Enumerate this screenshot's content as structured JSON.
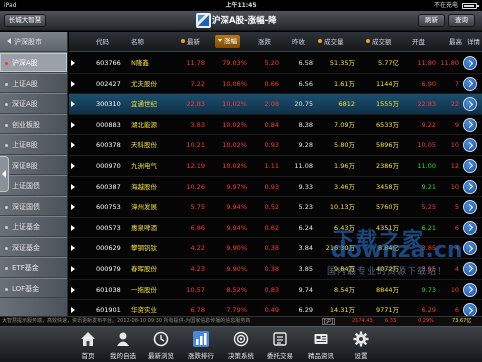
{
  "status_bar": {
    "device": "iPad",
    "time": "上午11:45",
    "right": "不在充电"
  },
  "header": {
    "back": "长城大智慧",
    "title": "沪深A股-涨幅-降",
    "refresh": "刷新",
    "search": "查询"
  },
  "sidebar": {
    "heading": "沪深股市",
    "items": [
      {
        "label": "沪深A股",
        "active": true
      },
      {
        "label": "上证A股"
      },
      {
        "label": "深证A股"
      },
      {
        "label": "创业板股"
      },
      {
        "label": "上证B股"
      },
      {
        "label": "深证B股"
      },
      {
        "label": "上证国债"
      },
      {
        "label": "深证国债"
      },
      {
        "label": "上证基金"
      },
      {
        "label": "深证基金"
      },
      {
        "label": "ETF基金"
      },
      {
        "label": "LOF基金"
      }
    ]
  },
  "table": {
    "columns": [
      "代码",
      "名称",
      "最新",
      "涨幅",
      "涨跌",
      "昨收",
      "成交量",
      "成交额",
      "开盘",
      "最高",
      "详情"
    ],
    "rows": [
      {
        "code": "603766",
        "name": "N隆鑫",
        "last": "11.78",
        "pct": "79.03%",
        "chg": "5.20",
        "prev": "6.58",
        "vol": "51.35万",
        "amt": "5.77亿",
        "open": "11.80",
        "high": "11.80",
        "dir": "up"
      },
      {
        "code": "002427",
        "name": "尤夫股份",
        "last": "7.22",
        "pct": "10.06%",
        "chg": "0.66",
        "prev": "6.56",
        "vol": "1.61万",
        "amt": "1144万",
        "open": "6.90",
        "high": "7",
        "dir": "up"
      },
      {
        "code": "300310",
        "name": "宜通世纪",
        "last": "22.83",
        "pct": "10.02%",
        "chg": "2.08",
        "prev": "20.75",
        "vol": "6812",
        "amt": "1555万",
        "open": "22.83",
        "high": "22",
        "dir": "up",
        "highlight": true
      },
      {
        "code": "000883",
        "name": "湖北能源",
        "last": "3.83",
        "pct": "10.02%",
        "chg": "0.84",
        "prev": "8.38",
        "vol": "7.09万",
        "amt": "6533万",
        "open": "9.22",
        "high": "9",
        "dir": "up"
      },
      {
        "code": "600378",
        "name": "天科股份",
        "last": "10.21",
        "pct": "10.02%",
        "chg": "0.93",
        "prev": "9.28",
        "vol": "5.80万",
        "amt": "5896万",
        "open": "10.05",
        "high": "10",
        "dir": "up"
      },
      {
        "code": "000970",
        "name": "九洲电气",
        "last": "12.19",
        "pct": "10.02%",
        "chg": "1.11",
        "prev": "11.08",
        "vol": "1.96万",
        "amt": "2386万",
        "open": "11.00",
        "high": "12",
        "dir": "up"
      },
      {
        "code": "600387",
        "name": "海越股份",
        "last": "10.26",
        "pct": "9.97%",
        "chg": "0.93",
        "prev": "9.33",
        "vol": "3.46万",
        "amt": "3458万",
        "open": "9.21",
        "high": "10",
        "dir": "up"
      },
      {
        "code": "600753",
        "name": "漳州发展",
        "last": "5.75",
        "pct": "9.94%",
        "chg": "0.52",
        "prev": "5.23",
        "vol": "10.13万",
        "amt": "5760万",
        "open": "5.25",
        "high": "5",
        "dir": "up"
      },
      {
        "code": "000573",
        "name": "惠泉啤酒",
        "last": "6.86",
        "pct": "9.94%",
        "chg": "0.62",
        "prev": "6.24",
        "vol": "6.43万",
        "amt": "4351万",
        "open": "6.21",
        "high": "6",
        "dir": "up"
      },
      {
        "code": "000629",
        "name": "攀钢钒钛",
        "last": "4.22",
        "pct": "9.90%",
        "chg": "0.38",
        "prev": "3.84",
        "vol": "216.30万",
        "amt": "8.84亿",
        "open": "3.85",
        "high": "4",
        "dir": "up"
      },
      {
        "code": "000979",
        "name": "春晖股份",
        "last": "4.23",
        "pct": "9.90%",
        "chg": "0.38",
        "prev": "3.85",
        "vol": "9.84万",
        "amt": "4072万",
        "open": "3.95",
        "high": "4",
        "dir": "up"
      },
      {
        "code": "601038",
        "name": "一拖股份",
        "last": "10.57",
        "pct": "8.52%",
        "chg": "0.83",
        "prev": "9.74",
        "vol": "8.54万",
        "amt": "8844万",
        "open": "9.73",
        "high": "10",
        "dir": "up"
      },
      {
        "code": "601901",
        "name": "华资实业",
        "last": "6.78",
        "pct": "7.79%",
        "chg": "0.49",
        "prev": "6.29",
        "vol": "14.31万",
        "amt": "9771万",
        "open": "6.29",
        "high": "6",
        "dir": "up"
      },
      {
        "code": "600000",
        "name": "宝钢股份",
        "last": "12.31",
        "pct": "6.22%",
        "chg": "",
        "prev": "",
        "vol": "",
        "amt": "",
        "open": "",
        "high": "",
        "dir": "up"
      }
    ]
  },
  "watermark": {
    "line1": "下载之家",
    "line2": "downza.cn",
    "line3": "国内最专业的资源下载站！"
  },
  "ticker": {
    "text": "大智慧提示服务端，高效快速，资讯更新发布平台。2012-08-10 09:30 所有提供·为国家信息传播的信息服务商",
    "box": "[沪]",
    "index": "2174.43",
    "chg": "6.33",
    "pct": "0.29%",
    "amt": "73.67亿"
  },
  "tabs": [
    {
      "label": "首页",
      "icon": "home-icon"
    },
    {
      "label": "我的自选",
      "icon": "person-icon"
    },
    {
      "label": "最新浏览",
      "icon": "clock-icon"
    },
    {
      "label": "涨跌排行",
      "icon": "ranking-icon"
    },
    {
      "label": "决策系统",
      "icon": "target-icon"
    },
    {
      "label": "委托交易",
      "icon": "trade-icon"
    },
    {
      "label": "精品资讯",
      "icon": "news-icon"
    },
    {
      "label": "设置",
      "icon": "gear-icon"
    }
  ],
  "colors": {
    "up": "#ff3838",
    "down": "#20e020",
    "name": "#f2e03a",
    "highlight": "#1b4f6e"
  }
}
